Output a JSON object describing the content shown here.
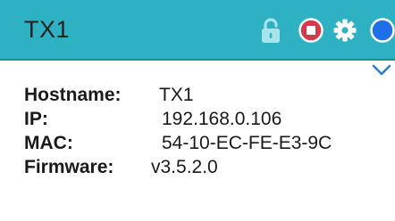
{
  "header": {
    "title": "TX1",
    "icons": [
      "lock-icon",
      "record-stop-icon",
      "gear-icon",
      "status-dot-icon"
    ],
    "colors": {
      "background": "#2eb1c2",
      "lock": "#a8e4ea",
      "record": "#d63a4a",
      "gear": "#ffffff",
      "status": "#1e6fe8"
    }
  },
  "expand": {
    "icon": "chevron-down-icon"
  },
  "info": {
    "rows": [
      {
        "label": "Hostname:",
        "value": "TX1"
      },
      {
        "label": "IP:",
        "value": "192.168.0.106"
      },
      {
        "label": "MAC:",
        "value": "54-10-EC-FE-E3-9C"
      },
      {
        "label": "Firmware:",
        "value": "v3.5.2.0"
      }
    ]
  }
}
